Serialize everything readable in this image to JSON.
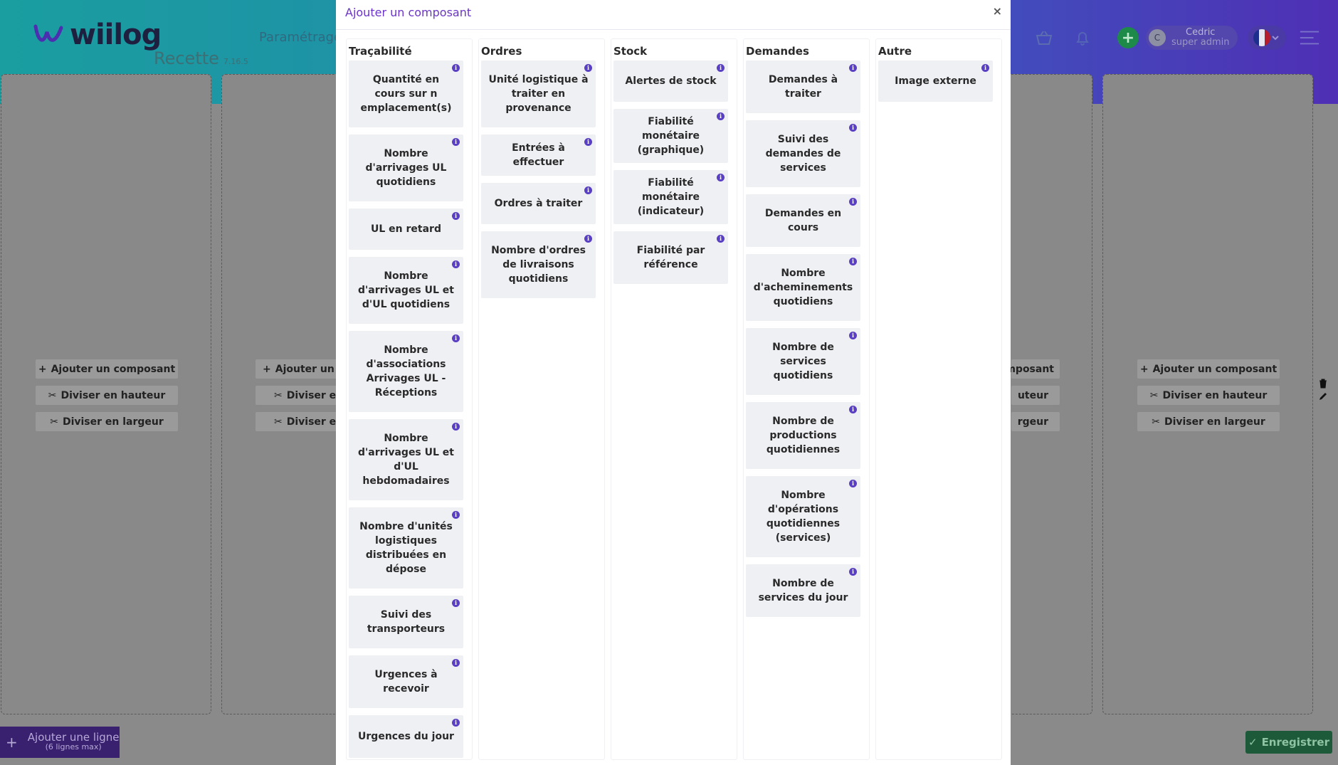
{
  "app": {
    "logo_text": "wiilog",
    "env_label": "Recette",
    "env_version": "7.16.5",
    "nav_item": "Paramétrage",
    "user": {
      "initial": "C",
      "name": "Cedric",
      "role": "super admin"
    },
    "colors": {
      "accent": "#6a35c8",
      "info": "#5a3fc2",
      "save": "#1d5a3a"
    }
  },
  "grid": {
    "actions": {
      "add": "Ajouter un composant",
      "split_height": "Diviser en hauteur",
      "split_width": "Diviser en largeur"
    },
    "partial_left": {
      "add": "Ajouter un c",
      "split_height": "Diviser en",
      "split_width": "Diviser en"
    },
    "partial_right": {
      "add": "mposant",
      "split_height": "uteur",
      "split_width": "rgeur"
    },
    "add_line": "Ajouter une ligne",
    "add_line_sub": "(6 lignes max)",
    "save": "Enregistrer"
  },
  "modal": {
    "title": "Ajouter un composant",
    "close": "×",
    "categories": [
      {
        "title": "Traçabilité",
        "items": [
          "Quantité en cours sur n emplacement(s)",
          "Nombre d'arrivages UL quotidiens",
          "UL en retard",
          "Nombre d'arrivages UL et d'UL quotidiens",
          "Nombre d'associations Arrivages UL - Réceptions",
          "Nombre d'arrivages UL et d'UL hebdomadaires",
          "Nombre d'unités logistiques distribuées en dépose",
          "Suivi des transporteurs",
          "Urgences à recevoir",
          "Urgences du jour"
        ]
      },
      {
        "title": "Ordres",
        "items": [
          "Unité logistique à traiter en provenance",
          "Entrées à effectuer",
          "Ordres à traiter",
          "Nombre d'ordres de livraisons quotidiens"
        ]
      },
      {
        "title": "Stock",
        "items": [
          "Alertes de stock",
          "Fiabilité monétaire (graphique)",
          "Fiabilité monétaire (indicateur)",
          "Fiabilité par référence"
        ]
      },
      {
        "title": "Demandes",
        "items": [
          "Demandes à traiter",
          "Suivi des demandes de services",
          "Demandes en cours",
          "Nombre d'acheminements quotidiens",
          "Nombre de services quotidiens",
          "Nombre de productions quotidiennes",
          "Nombre d'opérations quotidiennes (services)",
          "Nombre de services du jour"
        ]
      },
      {
        "title": "Autre",
        "items": [
          "Image externe"
        ]
      }
    ]
  }
}
